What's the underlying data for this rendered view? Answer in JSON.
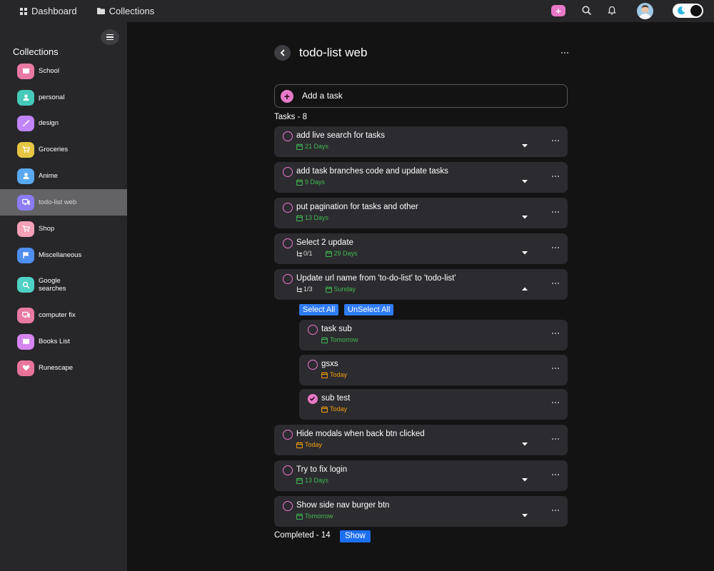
{
  "topbar": {
    "dashboard_label": "Dashboard",
    "collections_label": "Collections",
    "add_label": "+"
  },
  "sidebar": {
    "title": "Collections",
    "items": [
      {
        "label": "School",
        "color": "#e879a3",
        "icon": "book-icon"
      },
      {
        "label": "personal",
        "color": "#45c9b8",
        "icon": "person-icon"
      },
      {
        "label": "design",
        "color": "#c084fc",
        "icon": "brush-icon"
      },
      {
        "label": "Groceries",
        "color": "#e6c643",
        "icon": "cart-icon"
      },
      {
        "label": "Anime",
        "color": "#5aa9f0",
        "icon": "person-icon"
      },
      {
        "label": "todo-list web",
        "color": "#8b7cf6",
        "icon": "computer-icon"
      },
      {
        "label": "Shop",
        "color": "#f6a0b8",
        "icon": "cart-icon"
      },
      {
        "label": "Miscellaneous",
        "color": "#4f8ff0",
        "icon": "flag-icon"
      },
      {
        "label": "Google searches",
        "color": "#4fd1c5",
        "icon": "search-icon"
      },
      {
        "label": "computer fix",
        "color": "#e879a3",
        "icon": "computer-icon"
      },
      {
        "label": "Books List",
        "color": "#d685f0",
        "icon": "book-icon"
      },
      {
        "label": "Runescape",
        "color": "#e8749a",
        "icon": "heart-icon"
      }
    ]
  },
  "main": {
    "title": "todo-list web",
    "add_task_label": "Add a task",
    "tasks_label": "Tasks - 8",
    "select_all_label": "Select All",
    "unselect_all_label": "UnSelect All",
    "completed_label": "Completed - 14",
    "show_label": "Show",
    "tasks": [
      {
        "title": "add live search for tasks",
        "due": "21 Days",
        "due_color": "green",
        "subtasks": "",
        "expanded": false
      },
      {
        "title": "add task branches code and update tasks",
        "due": "9 Days",
        "due_color": "green",
        "subtasks": "",
        "expanded": false
      },
      {
        "title": "put pagination for tasks and other",
        "due": "13 Days",
        "due_color": "green",
        "subtasks": "",
        "expanded": false
      },
      {
        "title": "Select 2 update",
        "due": "29 Days",
        "due_color": "green",
        "subtasks": "0/1",
        "expanded": false
      },
      {
        "title": "Update url name from 'to-do-list' to 'todo-list'",
        "due": "Sunday",
        "due_color": "green",
        "subtasks": "1/3",
        "expanded": true
      },
      {
        "title": "Hide modals when back btn clicked",
        "due": "Today",
        "due_color": "orange",
        "subtasks": "",
        "expanded": false
      },
      {
        "title": "Try to fix login",
        "due": "13 Days",
        "due_color": "green",
        "subtasks": "",
        "expanded": false
      },
      {
        "title": "Show side nav burger btn",
        "due": "Tomorrow",
        "due_color": "green",
        "subtasks": "",
        "expanded": false
      }
    ],
    "subtasks": [
      {
        "title": "task sub",
        "due": "Tomorrow",
        "due_color": "green",
        "done": false
      },
      {
        "title": "gsxs",
        "due": "Today",
        "due_color": "orange",
        "done": false
      },
      {
        "title": "sub test",
        "due": "Today",
        "due_color": "orange",
        "done": true
      }
    ]
  }
}
